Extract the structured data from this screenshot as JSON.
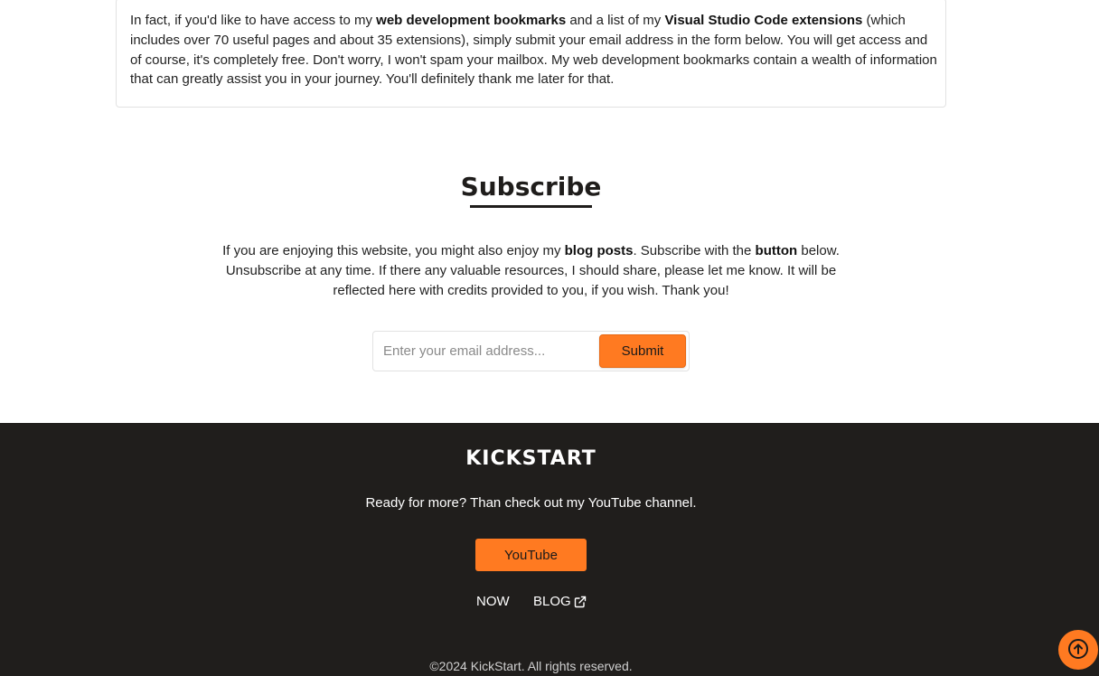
{
  "intro_card": {
    "t1": "In fact, if you'd like to have access to my ",
    "b1": "web development bookmarks",
    "t2": " and a list of my ",
    "b2": "Visual Studio Code extensions",
    "t3": " (which includes over 70 useful pages and about 35 extensions), simply submit your email address in the form below. You will get access and of course, it's completely free. Don't worry, I won't spam your mailbox. My web development bookmarks contain a wealth of information that can greatly assist you in your journey. You'll definitely thank me later for that."
  },
  "subscribe": {
    "title": "Subscribe",
    "t1": "If you are enjoying this website, you might also enjoy my ",
    "b1": "blog posts",
    "t2": ". Subscribe with the ",
    "b2": "button",
    "t3": " below. Unsubscribe at any time. If there any valuable resources, I should share, please let me know. It will be reflected here with credits provided to you, if you wish. Thank you!",
    "email_placeholder": "Enter your email address...",
    "submit_label": "Submit"
  },
  "footer": {
    "brand": "KICKSTART",
    "tagline": "Ready for more? Than check out my YouTube channel.",
    "youtube_label": "YouTube",
    "nav_now": "NOW",
    "nav_blog": "BLOG",
    "copyright": "©2024 KickStart. All rights reserved."
  },
  "colors": {
    "accent": "#ff7a21",
    "footer_bg": "#201e1c"
  },
  "icons": {
    "blog_link": "external-link-icon",
    "scroll": "arrow-up-circle-icon"
  }
}
